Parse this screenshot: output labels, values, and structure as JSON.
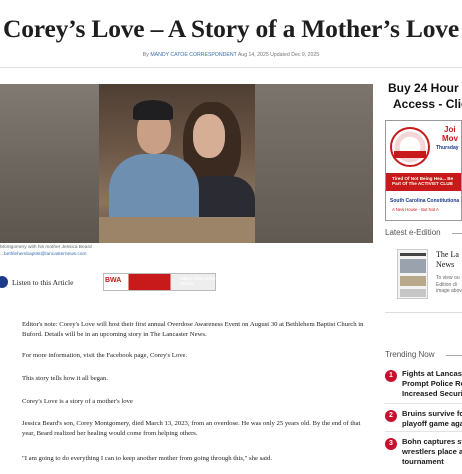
{
  "article": {
    "title": "Corey’s Love – A Story of a Mother’s Love",
    "byline_prefix": "By",
    "author": "MANDY CATOE CORRESPONDENT",
    "dates": "Aug 14, 2025 Updated Dec 9, 2025",
    "image_caption": "Montgomery with his mother Jessica Beard",
    "image_credit": "...bethlehembaptist@lancasternews.com",
    "listen_label": "Listen to this Article",
    "paragraphs": [
      "Editor's note: Corey's Love will host their first annual Overdose Awareness Event on August 30 at Bethlehem Baptist Church in Buford. Details will be in an upcoming story in The Lancaster News.",
      "For more information, visit the Facebook page, Corey's Love.",
      "This story tells how it all began.",
      "Corey's Love is a story of a mother's love",
      "Jessica Beard's son, Corey Montgomery, died March 13, 2023, from an overdose. He was only 25 years old. By the end of that year, Beard realized her healing would come from helping others.",
      "\"I am going to do everything I can to keep another mother from going through this,\" she said."
    ]
  },
  "ad_banner": {
    "brand": "BWA",
    "text": "Billion Head Save Money"
  },
  "sidebar": {
    "promo_line1": "Buy 24 Hour W",
    "promo_line2": "Access - Click",
    "ad": {
      "join": "Joi",
      "movement": "Mov",
      "day": "Thursday",
      "tagline": "Tired Of Not Being Hea... Be Part Of The ACTIVIST CLUB",
      "org": "South Carolina Constitutiona",
      "slogan": "A New House - But Not A"
    },
    "latest_label": "Latest e-Edition",
    "latest_title": "The La News",
    "latest_desc": "To view ou Edition cli image abov",
    "trending_label": "Trending Now",
    "trending": [
      {
        "num": "1",
        "text": "Fights at Lancaste Prompt Police Res Increased Securit"
      },
      {
        "num": "2",
        "text": "Bruins survive fou playoff game aga"
      },
      {
        "num": "3",
        "text": "Bohn captures sta wrestlers place at tournament"
      }
    ]
  },
  "colors": {
    "accent_red": "#c8102e",
    "link_blue": "#3a6fb0",
    "listen_blue": "#1b3a8a"
  }
}
